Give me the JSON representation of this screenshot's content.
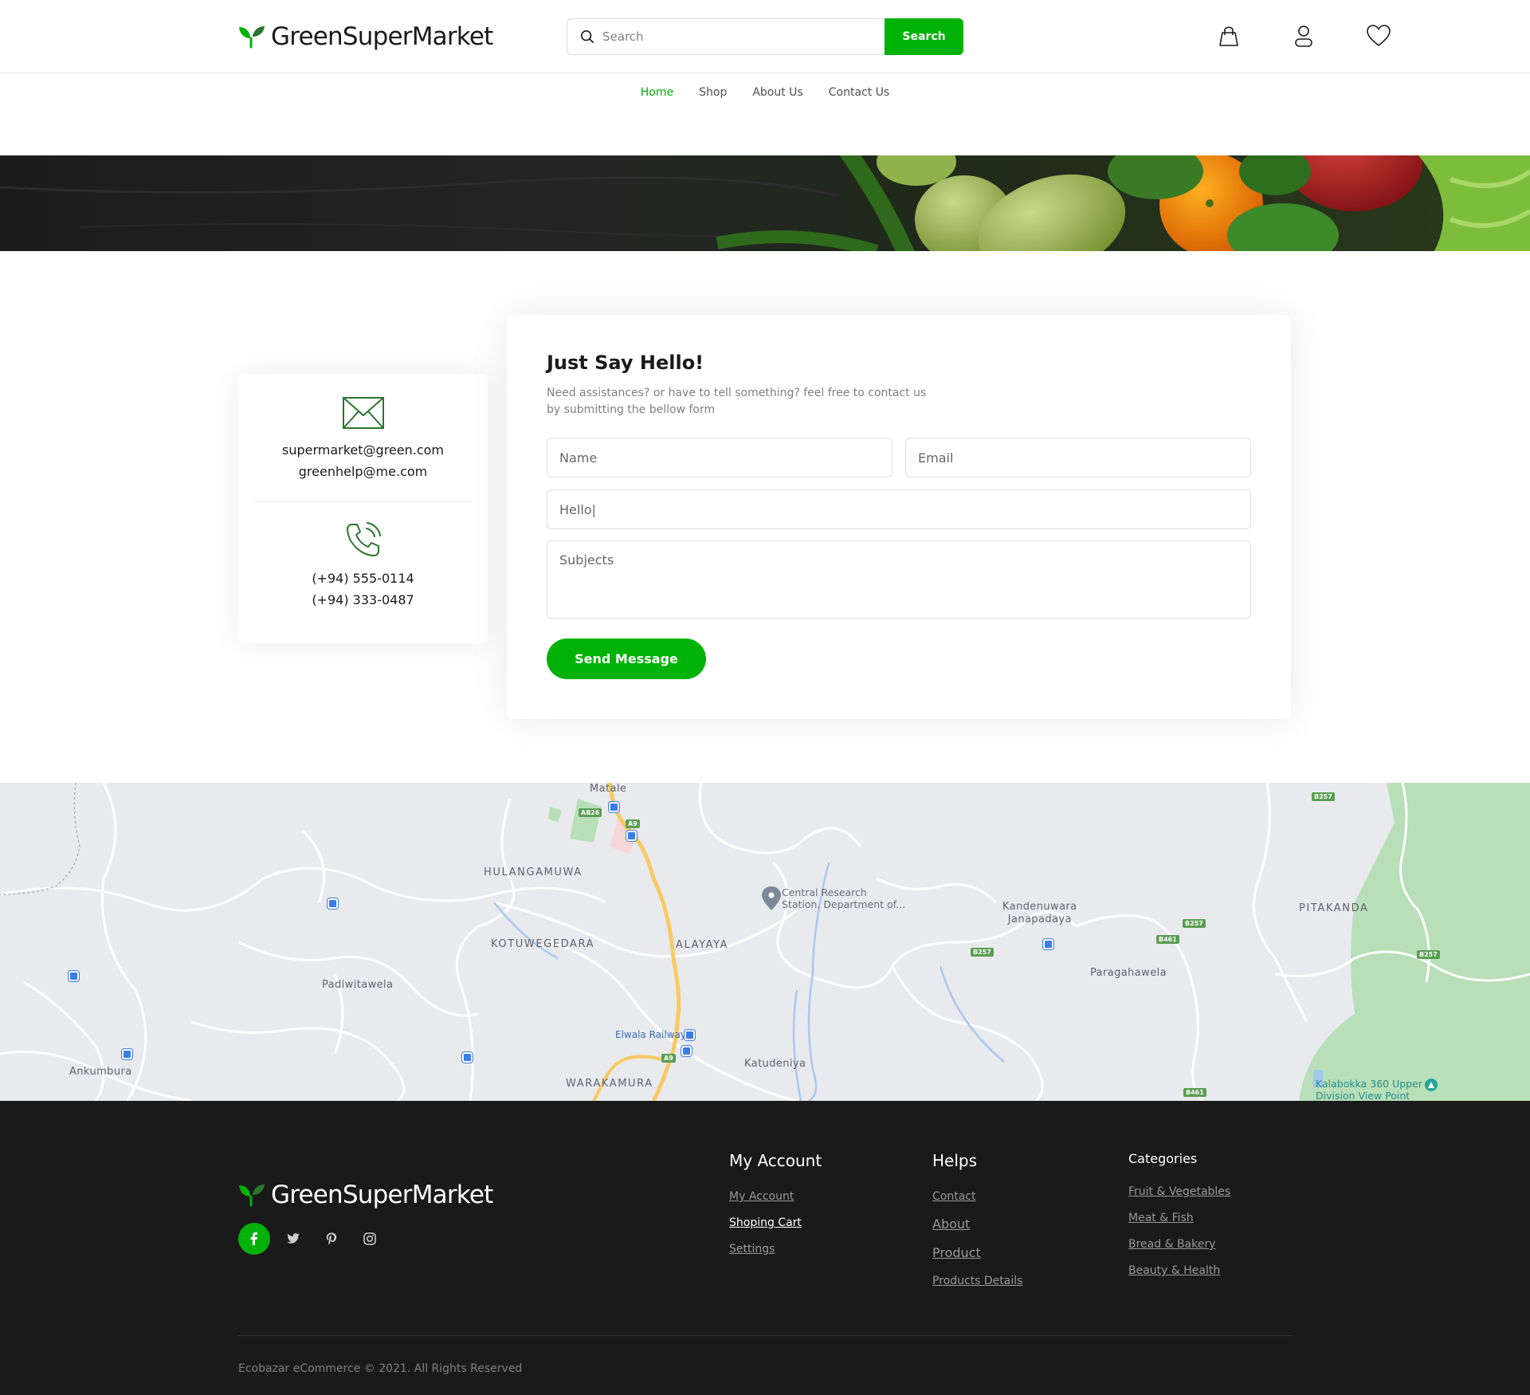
{
  "header": {
    "brand": "GreenSuperMarket",
    "search_placeholder": "Search",
    "search_button": "Search",
    "colors": {
      "accent": "#00b207",
      "text": "#1a1a1a"
    }
  },
  "nav": {
    "items": [
      {
        "label": "Home",
        "active": true
      },
      {
        "label": "Shop"
      },
      {
        "label": "About Us"
      },
      {
        "label": "Contact Us"
      }
    ]
  },
  "contact_info": {
    "emails": [
      "supermarket@green.com",
      "greenhelp@me.com"
    ],
    "phones": [
      "(+94) 555-0114",
      "(+94) 333-0487"
    ]
  },
  "form": {
    "title": "Just Say Hello!",
    "subtitle_line1": "Need assistances? or have to tell something? feel free to contact us",
    "subtitle_line2": "by submitting the bellow form",
    "name_placeholder": "Name",
    "email_placeholder": "Email",
    "message_placeholder": "Hello|",
    "subjects_placeholder": "Subjects",
    "submit_label": "Send Message"
  },
  "map": {
    "labels": {
      "matale": "Matale",
      "hulangamuwa": "HULANGAMUWA",
      "kotuwegedara": "KOTUWEGEDARA",
      "alayaya": "ALAYAYA",
      "padiwitawela": "Padiwitawela",
      "ankumbura": "Ankumbura",
      "warakamura": "WARAKAMURA",
      "katudeniya": "Katudeniya",
      "elwala": "Elwala Railway",
      "central_line1": "Central Research",
      "central_line2": "Station, Department of...",
      "kandenuwara_line1": "Kandenuwara",
      "kandenuwara_line2": "Janapadaya",
      "paragahawela": "Paragahawela",
      "pitakanda": "PITAKANDA",
      "kalabokka_line1": "Kalabokka 360 Upper",
      "kalabokka_line2": "Division View Point"
    },
    "road_badges": {
      "ab26": "AB26",
      "a9_top": "A9",
      "a9_bottom": "A9",
      "b257_a": "B257",
      "b257_b": "B257",
      "b257_c": "B257",
      "b257_d": "B257",
      "b461_a": "B461",
      "b461_b": "B461"
    }
  },
  "footer": {
    "brand": "GreenSuperMarket",
    "my_account": {
      "heading": "My Account",
      "links": [
        "My Account",
        "Shoping Cart",
        "Settings"
      ]
    },
    "helps": {
      "heading": "Helps",
      "links": [
        "Contact",
        "About",
        "Product",
        "Products Details"
      ]
    },
    "categories": {
      "heading": "Categories",
      "links": [
        "Fruit & Vegetables",
        "Meat & Fish",
        "Bread & Bakery",
        "Beauty & Health"
      ]
    },
    "copyright": "Ecobazar eCommerce © 2021. All Rights Reserved",
    "social_icons": [
      "facebook-icon",
      "twitter-icon",
      "pinterest-icon",
      "instagram-icon"
    ]
  }
}
